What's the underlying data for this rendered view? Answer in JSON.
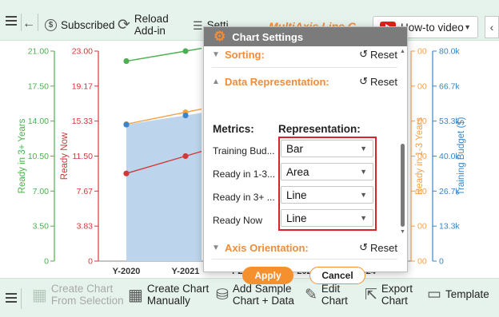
{
  "toolbar_top": {
    "subscribed_label": "Subscribed",
    "reload_line1": "Reload",
    "reload_line2": "Add-in",
    "settings_label": "Setti",
    "brand_text": "MultiAxis Line C",
    "video_label": "How-to video",
    "collapse_glyph": "‹"
  },
  "toolbar_bottom": {
    "create_selection_line1": "Create Chart",
    "create_selection_line2": "From Selection",
    "create_manual_line1": "Create Chart",
    "create_manual_line2": "Manually",
    "add_sample_line1": "Add Sample",
    "add_sample_line2": "Chart + Data",
    "edit_line1": "Edit",
    "edit_line2": "Chart",
    "export_line1": "Export",
    "export_line2": "Chart",
    "template_label": "Template"
  },
  "dialog": {
    "title": "Chart Settings",
    "sorting_label": "Sorting:",
    "data_rep_label": "Data Representation:",
    "axis_orient_label": "Axis Orientation:",
    "reset_label": "Reset",
    "metrics_header": "Metrics:",
    "representation_header": "Representation:",
    "rows": [
      {
        "metric": "Training Bud...",
        "representation": "Bar"
      },
      {
        "metric": "Ready in 1-3...",
        "representation": "Area"
      },
      {
        "metric": "Ready in 3+ ...",
        "representation": "Line"
      },
      {
        "metric": "Ready Now",
        "representation": "Line"
      }
    ],
    "apply_label": "Apply",
    "cancel_label": "Cancel"
  },
  "chart_data": {
    "type": "line",
    "categories": [
      "Y-2020",
      "Y-2021",
      "Y-2022",
      "Y-2023",
      "Y-2024"
    ],
    "axes": [
      {
        "name": "Ready in 3+ Years",
        "side": "left",
        "color": "#4caf50",
        "ylim": [
          0,
          21
        ],
        "ticks": [
          "0",
          "3.50",
          "7.00",
          "10.50",
          "14.00",
          "17.50",
          "21.00"
        ]
      },
      {
        "name": "Ready Now",
        "side": "left",
        "color": "#d33838",
        "ylim": [
          0,
          23
        ],
        "ticks": [
          "0",
          "3.83",
          "7.67",
          "11.50",
          "15.33",
          "19.17",
          "23.00"
        ]
      },
      {
        "name": "Ready in 1-3 Years",
        "side": "right",
        "color": "#f5a04a",
        "ticks": [
          "00",
          "00",
          "00",
          "00",
          "00",
          "00",
          "00"
        ]
      },
      {
        "name": "Training Budget ($)",
        "side": "right",
        "color": "#3a86c8",
        "ylim": [
          0,
          80
        ],
        "ticks": [
          "0",
          "13.3k",
          "26.7k",
          "40.0k",
          "53.3k",
          "66.7k",
          "80.0k"
        ]
      }
    ],
    "series": [
      {
        "name": "Ready in 3+ Years",
        "color": "#4caf50",
        "values": [
          20.0,
          21.0
        ]
      },
      {
        "name": "Ready Now",
        "color": "#d33838",
        "values": [
          9.6,
          11.5
        ]
      },
      {
        "name": "Ready in 1-3 Years",
        "color": "#f5a04a",
        "values": [
          15.0,
          16.3
        ]
      },
      {
        "name": "Training Budget ($)",
        "color": "#3a86c8",
        "values": [
          52.0,
          55.5
        ]
      }
    ],
    "partial_category_labels": [
      "r 2022",
      "r 2023",
      "r 2024"
    ]
  }
}
